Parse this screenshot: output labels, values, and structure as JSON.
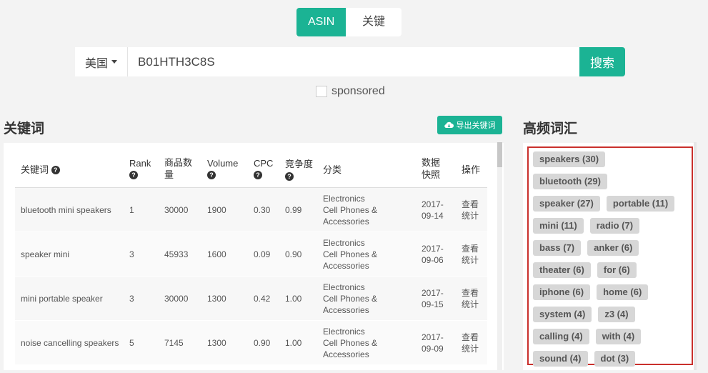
{
  "mode_toggle": {
    "asin_label": "ASIN",
    "keyword_label": "关键词"
  },
  "search": {
    "country": "美国",
    "value": "B01HTH3C8S",
    "button": "搜索"
  },
  "sponsored_label": "sponsored",
  "keywords_section": {
    "title": "关键词",
    "export_label": "导出关键词",
    "columns": [
      "关键词",
      "Rank",
      "商品数量",
      "Volume",
      "CPC",
      "竞争度",
      "分类",
      "数据快照",
      "操作"
    ],
    "rows": [
      {
        "keyword": "bluetooth mini speakers",
        "rank": "1",
        "products": "30000",
        "volume": "1900",
        "cpc": "0.30",
        "competition": "0.99",
        "category": [
          "Electronics",
          "Cell Phones &",
          "Accessories"
        ],
        "date": [
          "2017-",
          "09-14"
        ],
        "ops": [
          "查看",
          "统计"
        ]
      },
      {
        "keyword": "speaker mini",
        "rank": "3",
        "products": "45933",
        "volume": "1600",
        "cpc": "0.09",
        "competition": "0.90",
        "category": [
          "Electronics",
          "Cell Phones &",
          "Accessories"
        ],
        "date": [
          "2017-",
          "09-06"
        ],
        "ops": [
          "查看",
          "统计"
        ]
      },
      {
        "keyword": "mini portable speaker",
        "rank": "3",
        "products": "30000",
        "volume": "1300",
        "cpc": "0.42",
        "competition": "1.00",
        "category": [
          "Electronics",
          "Cell Phones &",
          "Accessories"
        ],
        "date": [
          "2017-",
          "09-15"
        ],
        "ops": [
          "查看",
          "统计"
        ]
      },
      {
        "keyword": "noise cancelling speakers",
        "rank": "5",
        "products": "7145",
        "volume": "1300",
        "cpc": "0.90",
        "competition": "1.00",
        "category": [
          "Electronics",
          "Cell Phones &",
          "Accessories"
        ],
        "date": [
          "2017-",
          "09-09"
        ],
        "ops": [
          "查看",
          "统计"
        ]
      }
    ]
  },
  "words_section": {
    "title": "高频词汇",
    "tags": [
      [
        "speakers (30)"
      ],
      [
        "bluetooth (29)"
      ],
      [
        "speaker (27)",
        "portable (11)"
      ],
      [
        "mini (11)",
        "radio (7)"
      ],
      [
        "bass (7)",
        "anker (6)"
      ],
      [
        "theater (6)",
        "for (6)"
      ],
      [
        "iphone (6)",
        "home (6)"
      ],
      [
        "system (4)",
        "z3 (4)"
      ],
      [
        "calling (4)",
        "with (4)"
      ],
      [
        "sound (4)",
        "dot (3)"
      ]
    ]
  },
  "colors": {
    "accent": "#1bb394",
    "highlight_border": "#c9302c",
    "tag_bg": "#d7d7d7"
  }
}
